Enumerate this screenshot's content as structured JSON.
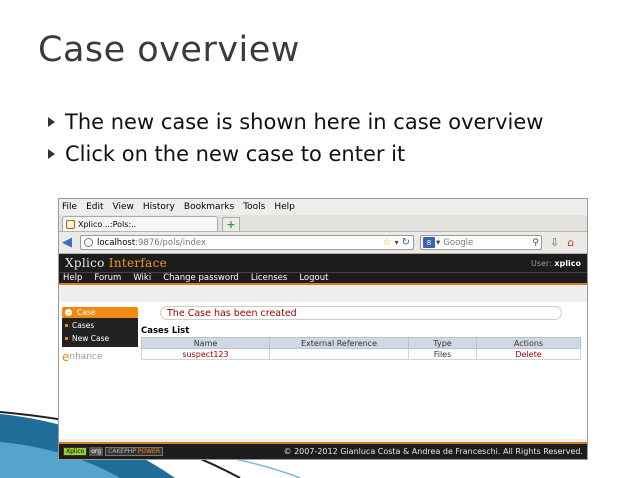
{
  "slide": {
    "title": "Case overview",
    "bullets": [
      "The new case is shown here in case overview",
      "Click on the new case to enter it"
    ]
  },
  "browser": {
    "menu": [
      "File",
      "Edit",
      "View",
      "History",
      "Bookmarks",
      "Tools",
      "Help"
    ],
    "tab_title": "Xplico ..:Pols:..",
    "url_host": "localhost",
    "url_path": ":9876/pols/index",
    "search_placeholder": "Google",
    "search_engine_badge": "8"
  },
  "app": {
    "logo_part1": "Xplico",
    "logo_part2": "Interface",
    "user_label": "User:",
    "user_name": "xplico",
    "nav": [
      "Help",
      "Forum",
      "Wiki",
      "Change password",
      "Licenses",
      "Logout"
    ],
    "sidebar_header": "Case",
    "sidebar_items": [
      "Cases",
      "New Case"
    ],
    "enhance_initial": "e",
    "enhance_rest": "nhance",
    "flash_message": "The Case has been created",
    "list_title": "Cases List",
    "table": {
      "headers": [
        "Name",
        "External Reference",
        "Type",
        "Actions"
      ],
      "rows": [
        {
          "name": "suspect123",
          "ext_ref": "",
          "type": "Files",
          "action": "Delete"
        }
      ]
    },
    "footer_badges": [
      "Xplico",
      "org",
      "CAKEPHP",
      "POWER"
    ],
    "copyright": "© 2007-2012 Gianluca Costa & Andrea de Franceschi. All Rights Reserved."
  },
  "colors": {
    "accent_orange": "#d7831a",
    "header_dark": "#1c1c1c",
    "flash_red": "#a0000a",
    "deco_blue": "#1f6e99"
  }
}
